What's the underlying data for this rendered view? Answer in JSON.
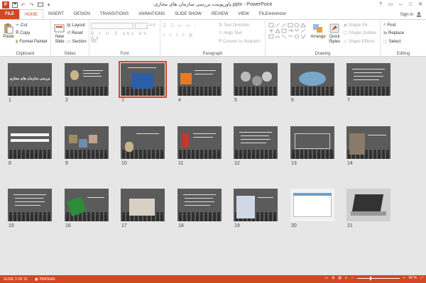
{
  "window": {
    "title": "پاورپوینت بررسی سازمان های مجازی.pptx - PowerPoint",
    "app_icon_letter": "P",
    "controls": [
      "?",
      "▭",
      "–",
      "□",
      "✕"
    ]
  },
  "ribbon_tabs": [
    "FILE",
    "HOME",
    "INSERT",
    "DESIGN",
    "TRANSITIONS",
    "ANIMATIONS",
    "SLIDE SHOW",
    "REVIEW",
    "VIEW",
    "FILEminimizer"
  ],
  "active_tab": "HOME",
  "account": {
    "signin": "Sign in"
  },
  "groups": {
    "clipboard": {
      "label": "Clipboard",
      "paste": "Paste",
      "cut": "Cut",
      "copy": "Copy",
      "format_painter": "Format Painter"
    },
    "slides": {
      "label": "Slides",
      "new_slide": "New Slide",
      "layout": "Layout",
      "reset": "Reset",
      "section": "Section"
    },
    "font": {
      "label": "Font"
    },
    "paragraph": {
      "label": "Paragraph",
      "text_direction": "Text Direction",
      "align_text": "Align Text",
      "convert_smartart": "Convert to SmartArt"
    },
    "drawing": {
      "label": "Drawing",
      "arrange": "Arrange",
      "quick_styles": "Quick Styles",
      "shape_fill": "Shape Fill",
      "shape_outline": "Shape Outline",
      "shape_effects": "Shape Effects"
    },
    "editing": {
      "label": "Editing",
      "find": "Find",
      "replace": "Replace",
      "select": "Select"
    }
  },
  "slides": [
    {
      "num": "1",
      "kind": "title",
      "title": "بررسی سازمان های مجازی"
    },
    {
      "num": "2",
      "kind": "image-left"
    },
    {
      "num": "3",
      "kind": "image-center",
      "selected": true
    },
    {
      "num": "4",
      "kind": "image-orange"
    },
    {
      "num": "5",
      "kind": "circles"
    },
    {
      "num": "6",
      "kind": "oval"
    },
    {
      "num": "7",
      "kind": "text"
    },
    {
      "num": "8",
      "kind": "text-bars"
    },
    {
      "num": "9",
      "kind": "photos"
    },
    {
      "num": "10",
      "kind": "bag"
    },
    {
      "num": "11",
      "kind": "red-figure"
    },
    {
      "num": "12",
      "kind": "text"
    },
    {
      "num": "13",
      "kind": "table"
    },
    {
      "num": "14",
      "kind": "people-photo"
    },
    {
      "num": "15",
      "kind": "text"
    },
    {
      "num": "16",
      "kind": "green-hands"
    },
    {
      "num": "17",
      "kind": "people-meeting"
    },
    {
      "num": "18",
      "kind": "text"
    },
    {
      "num": "19",
      "kind": "collage"
    },
    {
      "num": "20",
      "kind": "screenshot"
    },
    {
      "num": "21",
      "kind": "laptop"
    }
  ],
  "status": {
    "slide_info": "SLIDE 3 OF 21",
    "language": "PERSIAN",
    "zoom": "60 %",
    "zoom_fraction": 0.6
  },
  "colors": {
    "accent": "#d24726",
    "slide_bg": "#5b5b5b",
    "workspace": "#e6e6e6"
  }
}
